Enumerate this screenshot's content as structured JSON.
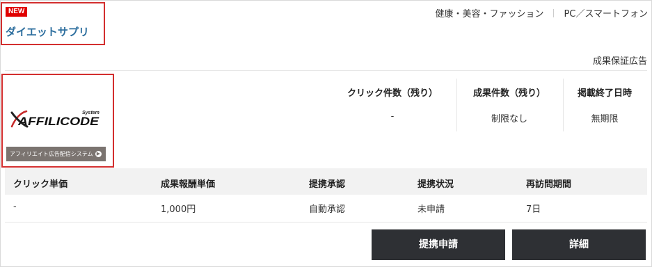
{
  "badge": "NEW",
  "title": "ダイエットサプリ",
  "categories": [
    "健康・美容・ファッション",
    "PC／スマートフォン"
  ],
  "ad_type": "成果保証広告",
  "logo": {
    "wordmark": "AFFILICODE",
    "superscript": "System",
    "subtitle": "アフィリエイト広告配信システム"
  },
  "stats": [
    {
      "label": "クリック件数（残り）",
      "value": "-"
    },
    {
      "label": "成果件数（残り）",
      "value": "制限なし"
    },
    {
      "label": "掲載終了日時",
      "value": "無期限"
    }
  ],
  "table": {
    "headers": [
      "クリック単価",
      "成果報酬単価",
      "提携承認",
      "提携状況",
      "再訪問期間"
    ],
    "row": [
      "-",
      "1,000円",
      "自動承認",
      "未申請",
      "7日"
    ]
  },
  "buttons": {
    "apply": "提携申請",
    "detail": "詳細"
  },
  "colors": {
    "highlight_border": "#d32f2f",
    "badge_bg": "#e00000",
    "title_link": "#2c6e9e",
    "button_bg": "#2e3034",
    "table_head_bg": "#f2f2f2"
  }
}
